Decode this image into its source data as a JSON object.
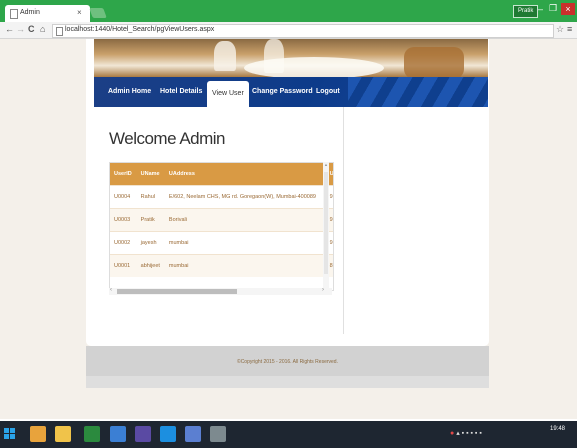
{
  "browser": {
    "tab_title": "Admin",
    "tab_close": "×",
    "url": "localhost:1440/Hotel_Search/pgViewUsers.aspx",
    "user_badge": "Pratik",
    "min": "–",
    "max": "❐",
    "close": "×",
    "back": "←",
    "forward": "→",
    "reload": "C",
    "home": "⌂",
    "star": "☆",
    "menu": "≡"
  },
  "nav": {
    "items": [
      {
        "label": "Admin Home"
      },
      {
        "label": "Hotel Details"
      },
      {
        "label": "View User"
      },
      {
        "label": "Change Password"
      },
      {
        "label": "Logout"
      }
    ]
  },
  "main": {
    "heading": "Welcome Admin"
  },
  "grid": {
    "columns": [
      "UserID",
      "UName",
      "UAddress",
      "U"
    ],
    "rows": [
      [
        "U0004",
        "Rahul",
        "E/602, Neelam CHS, MG rd. Goregaon(W), Mumbai-400089",
        "9"
      ],
      [
        "U0003",
        "Pratik",
        "Borivali",
        "9"
      ],
      [
        "U0002",
        "jayesh",
        "mumbai",
        "9"
      ],
      [
        "U0001",
        "abhijeet",
        "mumbai",
        "8"
      ]
    ]
  },
  "footer": {
    "copyright": "©Copyright 2015 - 2016. All Rights Reserved."
  },
  "taskbar": {
    "clock": "19:48"
  },
  "colors": {
    "chrome_green": "#2ea64a",
    "nav_blue": "#0d3b8a",
    "grid_header": "#d99a44",
    "grid_text": "#9a6a35"
  }
}
